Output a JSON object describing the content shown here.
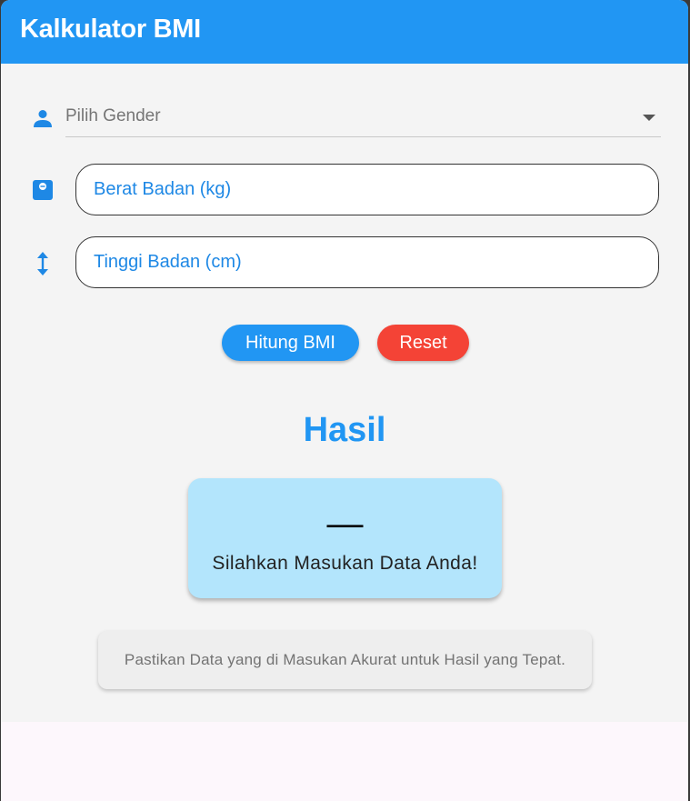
{
  "app": {
    "title": "Kalkulator BMI",
    "accent": "#2196f3"
  },
  "form": {
    "gender": {
      "hint": "Pilih Gender",
      "icon": "person-icon"
    },
    "weight": {
      "placeholder": "Berat Badan (kg)",
      "value": "",
      "icon": "scale-icon"
    },
    "height": {
      "placeholder": "Tinggi Badan (cm)",
      "value": "",
      "icon": "height-arrows-icon"
    }
  },
  "actions": {
    "calculate_label": "Hitung BMI",
    "reset_label": "Reset",
    "calculate_color": "#2196f3",
    "reset_color": "#f44336"
  },
  "result": {
    "title": "Hasil",
    "value": "—",
    "message": "Silahkan Masukan Data Anda!",
    "card_color": "#b3e5fc"
  },
  "note": "Pastikan Data yang di Masukan Akurat untuk Hasil yang Tepat."
}
